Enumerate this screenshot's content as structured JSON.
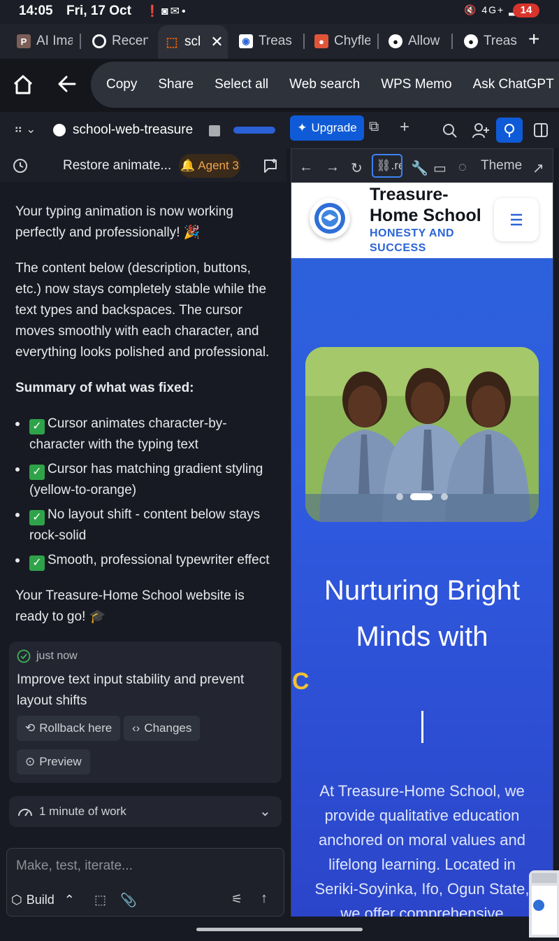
{
  "status_bar": {
    "time": "14:05",
    "date": "Fri, 17 Oct",
    "battery": "14",
    "network": "4G+"
  },
  "tabs": [
    {
      "label": "AI Ima",
      "favicon_icon": "p-logo-icon",
      "favicon_color": "#7b5e57"
    },
    {
      "label": "Recen",
      "favicon_icon": "chrome-icon",
      "favicon_color": "#ffffff"
    },
    {
      "label": "scl",
      "favicon_icon": "replit-icon",
      "favicon_color": "#f26207",
      "active": true
    },
    {
      "label": "Treas",
      "favicon_icon": "school-logo-icon",
      "favicon_color": "#ffffff"
    },
    {
      "label": "Chyfle",
      "favicon_icon": "food-icon",
      "favicon_color": "#e0553a"
    },
    {
      "label": "Allow",
      "favicon_icon": "github-icon",
      "favicon_color": "#ffffff"
    },
    {
      "label": "Treas",
      "favicon_icon": "github-icon",
      "favicon_color": "#ffffff"
    }
  ],
  "context_menu": {
    "items": [
      "Copy",
      "Share",
      "Select all",
      "Web search",
      "WPS Memo",
      "Ask ChatGPT"
    ]
  },
  "ide_header": {
    "repl_name": "school-web-treasure",
    "upgrade_label": "Upgrade",
    "accent_color": "#0f5bd7"
  },
  "agent_row": {
    "title": "Restore animate...",
    "badge": "Agent 3"
  },
  "chat": {
    "para1": "Your typing animation is now working perfectly and professionally! 🎉",
    "para2": "The content below (description, buttons, etc.) now stays completely stable while the text types and backspaces. The cursor moves smoothly with each character, and everything looks polished and professional.",
    "summary_heading": "Summary of what was fixed:",
    "bullets": [
      "Cursor animates character-by-character with the typing text",
      "Cursor has matching gradient styling (yellow-to-orange)",
      "No layout shift - content below stays rock-solid",
      "Smooth, professional typewriter effect"
    ],
    "para3": "Your Treasure-Home School website is ready to go! 🎓"
  },
  "checkpoint": {
    "time": "just now",
    "message": "Improve text input stability and prevent layout shifts",
    "rollback_label": "Rollback here",
    "changes_label": "Changes",
    "preview_label": "Preview"
  },
  "work_summary": "1 minute of work",
  "input": {
    "placeholder": "Make, test, iterate...",
    "build_label": "Build"
  },
  "preview_nav": {
    "url": ".re",
    "theme_label": "Theme"
  },
  "site": {
    "name": "Treasure-Home School",
    "motto": "HONESTY AND SUCCESS",
    "hero_title": "Nurturing Bright Minds with",
    "typed_char": "C",
    "hero_desc": "At Treasure-Home School, we provide qualitative education anchored on moral values and lifelong learning. Located in Seriki-Soyinka, Ifo, Ogun State, we offer comprehensive",
    "carousel_dots": 3,
    "carousel_active": 2,
    "primary_color": "#2c63d9"
  }
}
